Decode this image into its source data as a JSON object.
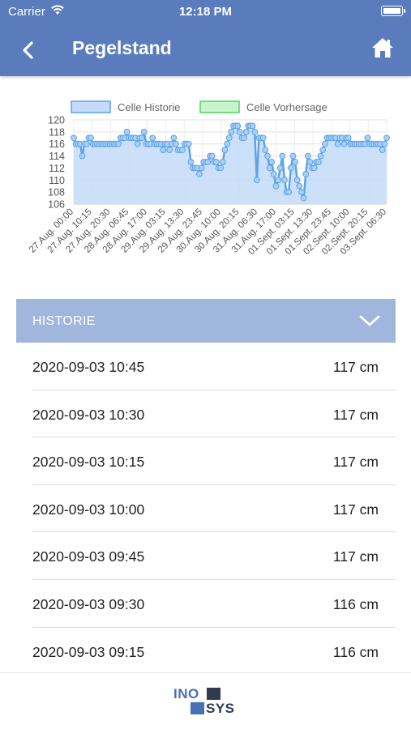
{
  "status": {
    "carrier": "Carrier",
    "time": "12:18 PM"
  },
  "nav": {
    "title": "Pegelstand"
  },
  "colors": {
    "brand": "#5a7cbd",
    "history_fill": "#c4daf8",
    "history_line": "#5da3e8",
    "forecast_fill": "#c9f3cc",
    "forecast_line": "#4fd36b",
    "header": "#a1b6dd"
  },
  "chart_data": {
    "type": "line",
    "legend": [
      "Celle Historie",
      "Celle Vorhersage"
    ],
    "legend_position": "top",
    "ylim": [
      106,
      120
    ],
    "yticks": [
      "120",
      "118",
      "116",
      "114",
      "112",
      "110",
      "108",
      "106"
    ],
    "xticks": [
      "27.Aug. 00:00",
      "27.Aug. 10:15",
      "27.Aug. 20:30",
      "28.Aug. 06:45",
      "28.Aug. 17:00",
      "29.Aug. 03:15",
      "29.Aug. 13:30",
      "29.Aug. 23:45",
      "30.Aug. 10:00",
      "30.Aug. 20:15",
      "31.Aug. 06:30",
      "31.Aug. 17:00",
      "01.Sept. 03:15",
      "01.Sept. 13:30",
      "01.Sept. 23:45",
      "02.Sept. 10:00",
      "02.Sept. 20:15",
      "03.Sept. 06:30"
    ],
    "grid": true,
    "series": [
      {
        "name": "Celle Historie",
        "area": true,
        "values": [
          117,
          116,
          116,
          116,
          114,
          116,
          116,
          117,
          117,
          116,
          116,
          116,
          116,
          116,
          116,
          116,
          116,
          116,
          116,
          116,
          116,
          116,
          117,
          117,
          117,
          118,
          117,
          117,
          117,
          117,
          116,
          117,
          117,
          118,
          116,
          116,
          116,
          117,
          116,
          116,
          116,
          116,
          115,
          116,
          116,
          115,
          116,
          117,
          116,
          115,
          115,
          115,
          116,
          116,
          116,
          113,
          112,
          112,
          112,
          111,
          112,
          113,
          113,
          113,
          114,
          114,
          113,
          113,
          112,
          112,
          113,
          115,
          116,
          117,
          118,
          119,
          119,
          119,
          118,
          117,
          117,
          118,
          119,
          119,
          119,
          118,
          110,
          117,
          117,
          117,
          115,
          114,
          112,
          113,
          111,
          109,
          110,
          112,
          114,
          110,
          108,
          108,
          112,
          114,
          113,
          110,
          109,
          108,
          107,
          111,
          114,
          113,
          112,
          112,
          113,
          113,
          114,
          115,
          116,
          117,
          117,
          117,
          117,
          117,
          116,
          117,
          117,
          116,
          117,
          117,
          116,
          116,
          116,
          116,
          116,
          116,
          116,
          116,
          117,
          116,
          116,
          116,
          116,
          116,
          116,
          115,
          116,
          117
        ]
      },
      {
        "name": "Celle Vorhersage",
        "area": true,
        "values": []
      }
    ]
  },
  "history": {
    "header": "HISTORIE",
    "rows": [
      {
        "date": "2020-09-03 10:45",
        "value": "117 cm"
      },
      {
        "date": "2020-09-03 10:30",
        "value": "117 cm"
      },
      {
        "date": "2020-09-03 10:15",
        "value": "117 cm"
      },
      {
        "date": "2020-09-03 10:00",
        "value": "117 cm"
      },
      {
        "date": "2020-09-03 09:45",
        "value": "117 cm"
      },
      {
        "date": "2020-09-03 09:30",
        "value": "116 cm"
      },
      {
        "date": "2020-09-03 09:15",
        "value": "116 cm"
      }
    ]
  },
  "footer": {
    "logo_top": "INO",
    "logo_bottom": "SYS"
  }
}
